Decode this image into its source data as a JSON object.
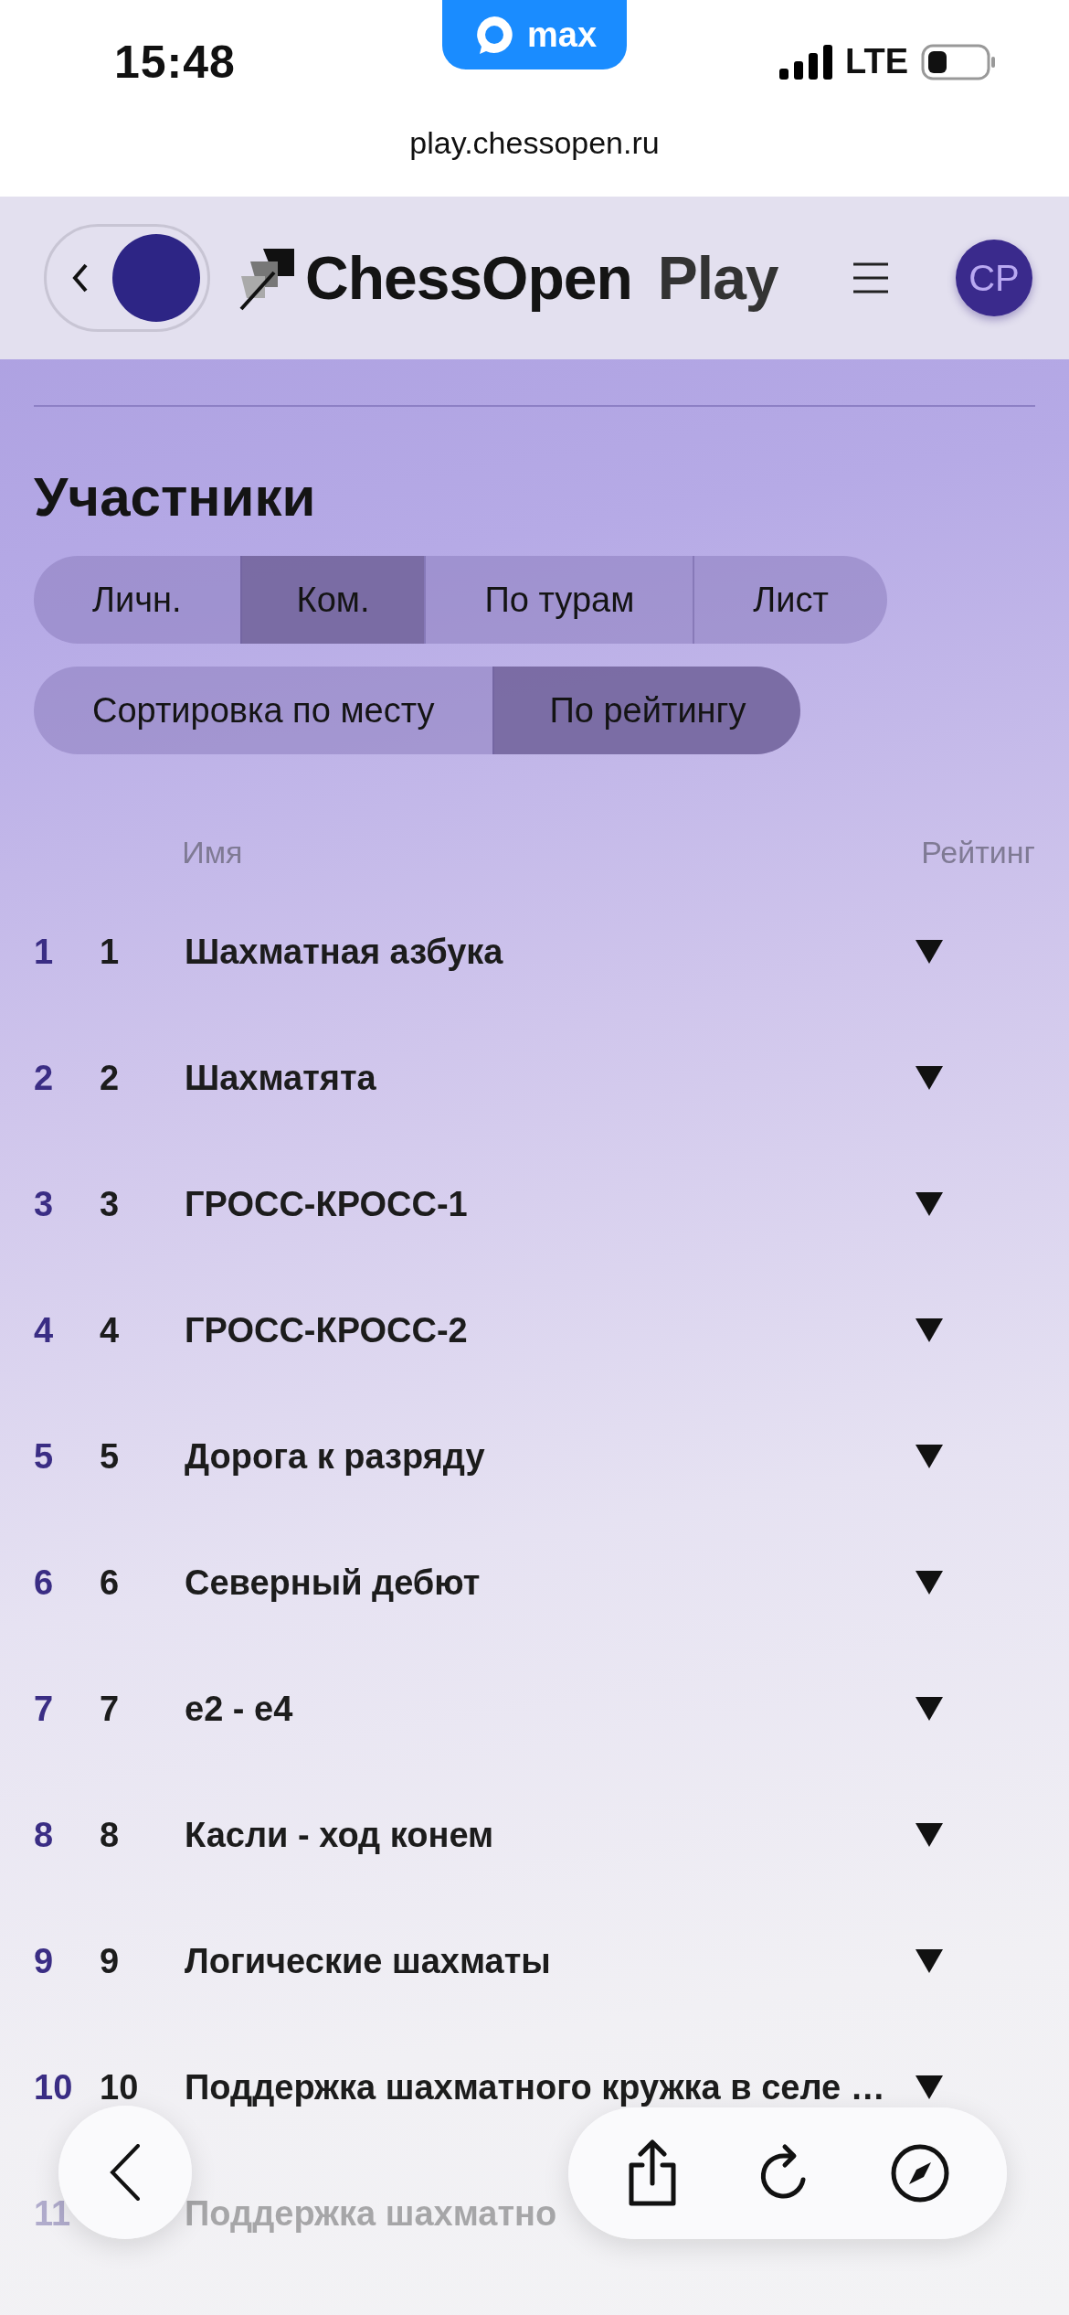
{
  "status_bar": {
    "time": "15:48",
    "app_badge": "max",
    "network": "LTE"
  },
  "address_bar": {
    "url": "play.chessopen.ru"
  },
  "header": {
    "brand": "ChessOpen",
    "brand_suffix": "Play",
    "avatar": "CP"
  },
  "title": "Участники",
  "view_tabs": [
    {
      "label": "Личн.",
      "selected": false
    },
    {
      "label": "Ком.",
      "selected": true
    },
    {
      "label": "По турам",
      "selected": false
    },
    {
      "label": "Лист",
      "selected": false
    }
  ],
  "sort_tabs": [
    {
      "label": "Сортировка по месту",
      "selected": false
    },
    {
      "label": "По рейтингу",
      "selected": true
    }
  ],
  "table": {
    "columns": [
      "Имя",
      "Рейтинг"
    ],
    "rows": [
      {
        "place": "1",
        "rank": "1",
        "name": "Шахматная азбука"
      },
      {
        "place": "2",
        "rank": "2",
        "name": "Шахматята"
      },
      {
        "place": "3",
        "rank": "3",
        "name": "ГРОСС-КРОСС-1"
      },
      {
        "place": "4",
        "rank": "4",
        "name": "ГРОСС-КРОСС-2"
      },
      {
        "place": "5",
        "rank": "5",
        "name": "Дорога к разряду"
      },
      {
        "place": "6",
        "rank": "6",
        "name": "Северный дебют"
      },
      {
        "place": "7",
        "rank": "7",
        "name": "e2 - e4"
      },
      {
        "place": "8",
        "rank": "8",
        "name": "Касли - ход конем"
      },
      {
        "place": "9",
        "rank": "9",
        "name": "Логические шахматы"
      },
      {
        "place": "10",
        "rank": "10",
        "name": "Поддержка шахматного кружка в селе …"
      },
      {
        "place": "11",
        "name": "Поддержка шахматно"
      }
    ]
  }
}
